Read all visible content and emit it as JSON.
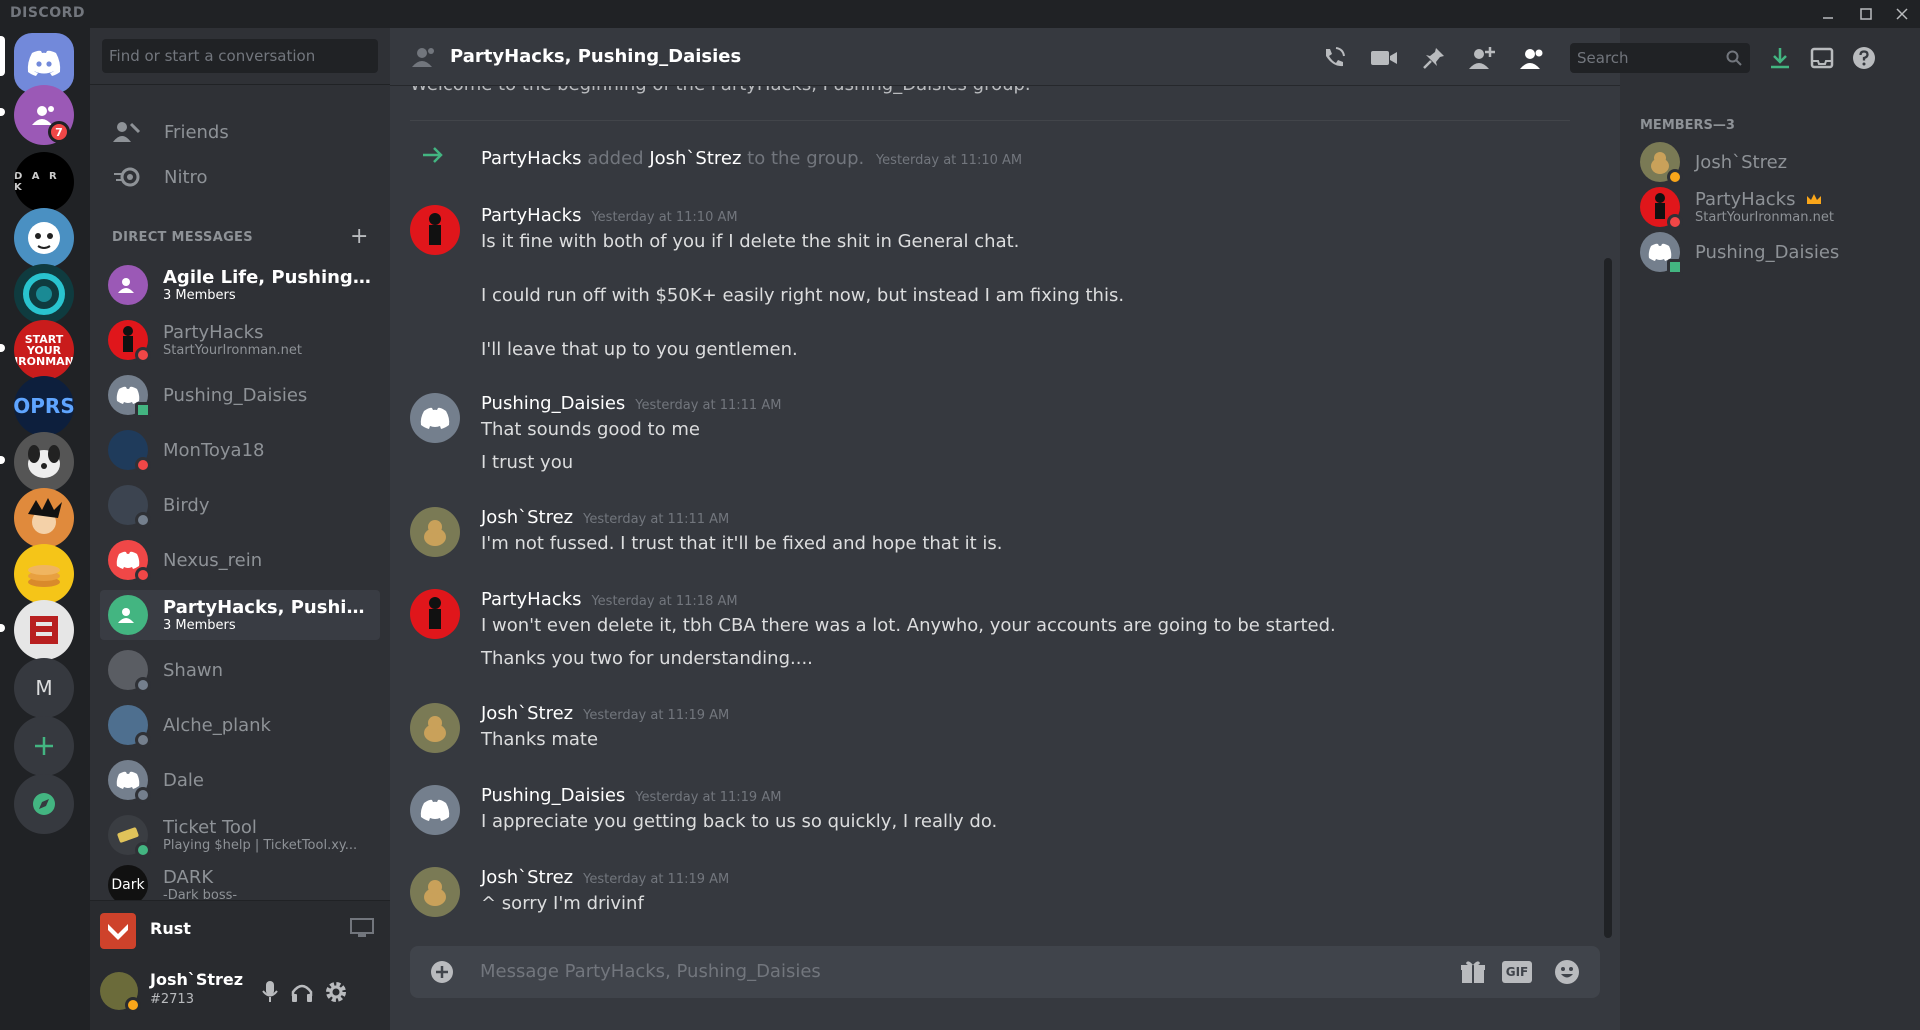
{
  "app": {
    "brand": "DISCORD"
  },
  "rail": {
    "home_badge": "7",
    "user_initial": "M",
    "dark_label": "D A R K",
    "start_label": "START YOUR IRONMAN",
    "oprs_label": "OPRS"
  },
  "dm_sidebar": {
    "search_placeholder": "Find or start a conversation",
    "nav": [
      {
        "label": "Friends"
      },
      {
        "label": "Nitro"
      }
    ],
    "header": "DIRECT MESSAGES",
    "add_symbol": "+",
    "items": [
      {
        "name": "Agile Life, Pushing_D...",
        "sub": "3 Members"
      },
      {
        "name": "PartyHacks",
        "sub": "StartYourIronman.net"
      },
      {
        "name": "Pushing_Daisies",
        "sub": ""
      },
      {
        "name": "MonToya18",
        "sub": ""
      },
      {
        "name": "Birdy",
        "sub": ""
      },
      {
        "name": "Nexus_rein",
        "sub": ""
      },
      {
        "name": "PartyHacks, Pushing_...",
        "sub": "3 Members"
      },
      {
        "name": "Shawn",
        "sub": ""
      },
      {
        "name": "Alche_plank",
        "sub": ""
      },
      {
        "name": "Dale",
        "sub": ""
      },
      {
        "name": "Ticket Tool",
        "sub": "Playing $help | TicketTool.xy..."
      },
      {
        "name": "DARK",
        "sub": "-Dark boss-"
      }
    ],
    "dark_avatar_text": "Dark",
    "activity": {
      "label": "Rust"
    },
    "user": {
      "name": "Josh`Strez",
      "tag": "#2713"
    }
  },
  "chat": {
    "title": "PartyHacks, Pushing_Daisies",
    "search_placeholder": "Search",
    "welcome": "Welcome to the beginning of the PartyHacks, Pushing_Daisies group.",
    "system": {
      "actor": "PartyHacks",
      "verb": "added",
      "target": "Josh`Strez",
      "rest": "to the group.",
      "ts": "Yesterday at 11:10 AM"
    },
    "messages": [
      {
        "author": "PartyHacks",
        "ts": "Yesterday at 11:10 AM",
        "lines": [
          "Is it fine with both of you if I delete the shit in General chat.",
          "I could run off with $50K+ easily right now, but instead I am fixing this.",
          "I'll leave that up to you gentlemen."
        ]
      },
      {
        "author": "Pushing_Daisies",
        "ts": "Yesterday at 11:11 AM",
        "lines": [
          "That sounds good to me",
          "I trust you"
        ]
      },
      {
        "author": "Josh`Strez",
        "ts": "Yesterday at 11:11 AM",
        "lines": [
          "I'm not fussed. I trust that it'll be fixed and hope that it is."
        ]
      },
      {
        "author": "PartyHacks",
        "ts": "Yesterday at 11:18 AM",
        "lines": [
          "I won't even delete it, tbh CBA there was a lot. Anywho, your accounts are going to be started.",
          "Thanks you two for understanding...."
        ]
      },
      {
        "author": "Josh`Strez",
        "ts": "Yesterday at 11:19 AM",
        "lines": [
          "Thanks mate"
        ]
      },
      {
        "author": "Pushing_Daisies",
        "ts": "Yesterday at 11:19 AM",
        "lines": [
          "I appreciate you getting back to us so quickly, I really do."
        ]
      },
      {
        "author": "Josh`Strez",
        "ts": "Yesterday at 11:19 AM",
        "lines": [
          "^ sorry I'm drivinf"
        ]
      }
    ],
    "composer_placeholder": "Message PartyHacks, Pushing_Daisies",
    "gif_label": "GIF"
  },
  "members": {
    "header": "MEMBERS—3",
    "list": [
      {
        "name": "Josh`Strez",
        "sub": ""
      },
      {
        "name": "PartyHacks",
        "sub": "StartYourIronman.net"
      },
      {
        "name": "Pushing_Daisies",
        "sub": ""
      }
    ]
  },
  "colors": {
    "online": "#43b581",
    "idle": "#faa61a",
    "dnd": "#f04747",
    "offline": "#747f8d",
    "blurple": "#7289da"
  }
}
